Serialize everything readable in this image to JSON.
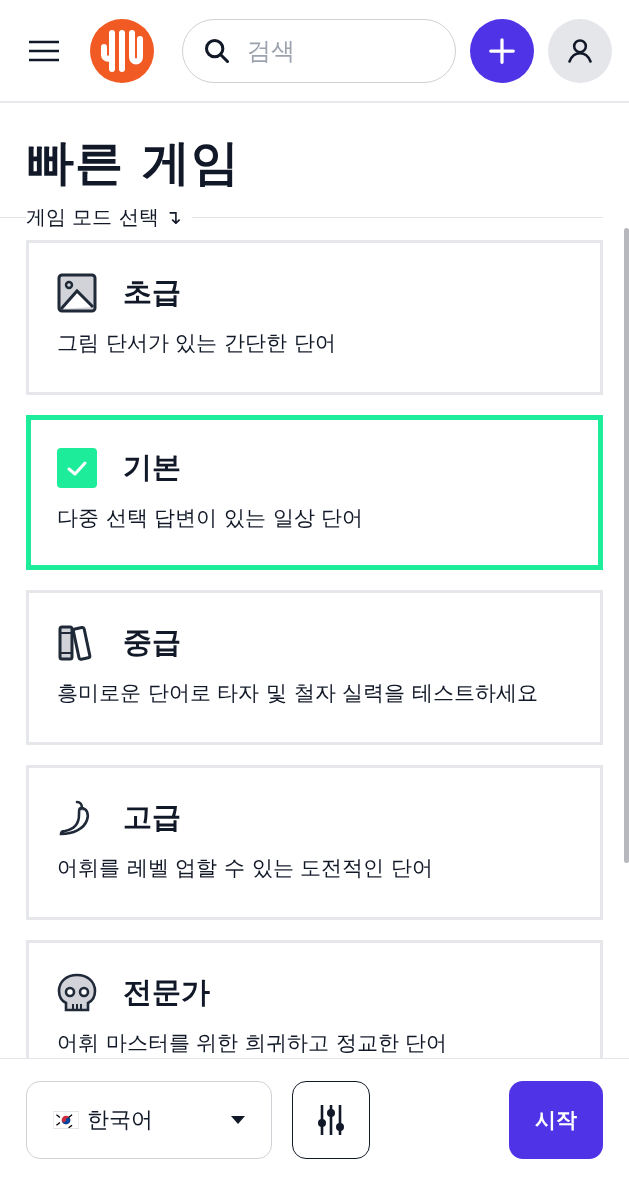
{
  "header": {
    "search": {
      "placeholder": "검색"
    }
  },
  "title": "빠른 게임",
  "mode_legend": "게임 모드 선택 ↴",
  "modes": [
    {
      "kind": "image",
      "name": "초급",
      "description": "그림 단서가 있는 간단한 단어",
      "selected": false
    },
    {
      "kind": "check",
      "name": "기본",
      "description": "다중 선택 답변이 있는 일상 단어",
      "selected": true
    },
    {
      "kind": "books",
      "name": "중급",
      "description": "흥미로운 단어로 타자 및 철자 실력을 테스트하세요",
      "selected": false
    },
    {
      "kind": "pepper",
      "name": "고급",
      "description": "어휘를 레벨 업할 수 있는 도전적인 단어",
      "selected": false
    },
    {
      "kind": "skull",
      "name": "전문가",
      "description": "어휘 마스터를 위한 희귀하고 정교한 단어",
      "selected": false
    }
  ],
  "footer": {
    "language": "한국어",
    "start_button": "시작"
  }
}
